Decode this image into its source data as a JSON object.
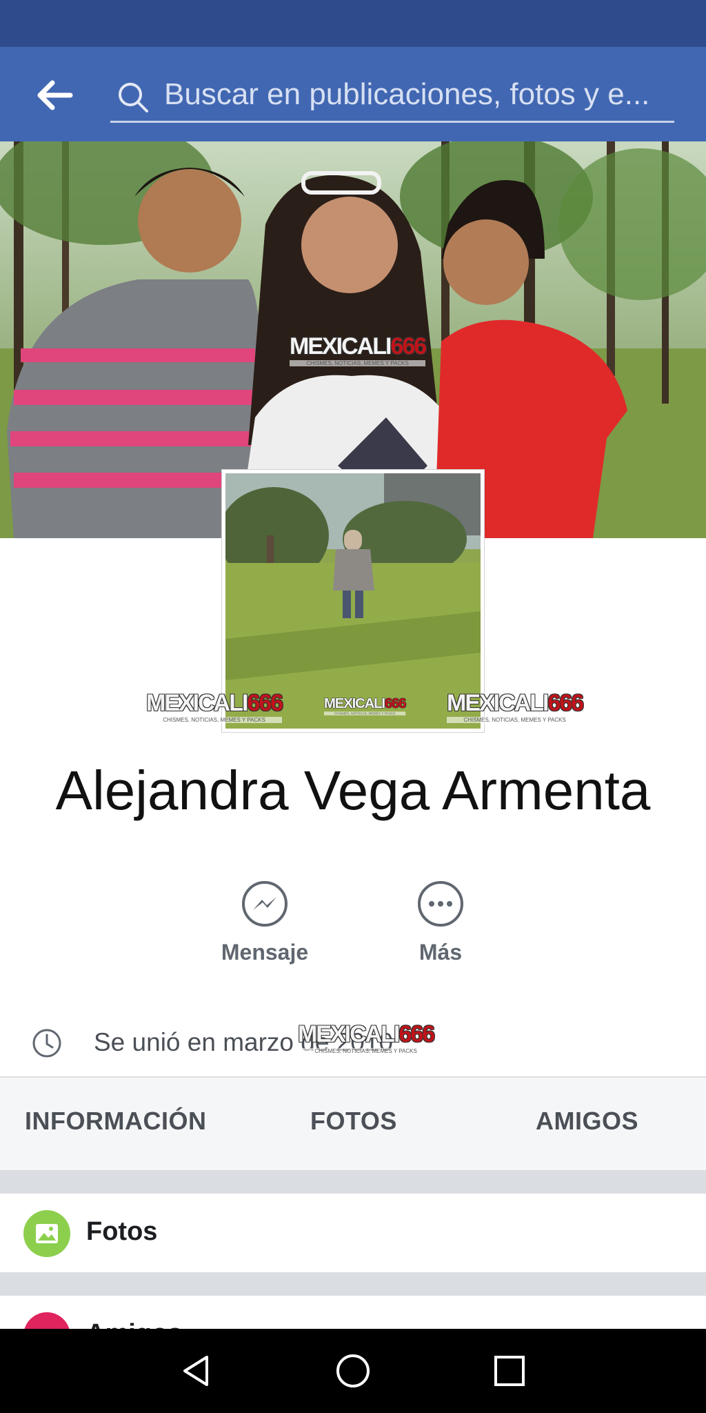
{
  "search": {
    "placeholder": "Buscar en publicaciones, fotos y e..."
  },
  "watermark": {
    "brand": "MEXICALI",
    "number": "666",
    "tagline": "CHISMES, NOTICIAS, MEMES Y PACKS"
  },
  "profile": {
    "name": "Alejandra Vega Armenta",
    "joined": "Se unió en marzo de 2010"
  },
  "actions": [
    {
      "label": "Mensaje",
      "icon": "messenger-icon"
    },
    {
      "label": "Más",
      "icon": "more-icon"
    }
  ],
  "tabs": [
    {
      "label": "INFORMACIÓN"
    },
    {
      "label": "FOTOS"
    },
    {
      "label": "AMIGOS"
    }
  ],
  "sections": {
    "photos": {
      "label": "Fotos",
      "icon": "photos-icon",
      "color": "#8ccf4d"
    },
    "friends": {
      "label": "Amigos",
      "icon": "friends-icon",
      "color": "#e0245e"
    }
  },
  "colors": {
    "header": "#4267b2",
    "status_bar": "#2f4b8c"
  }
}
